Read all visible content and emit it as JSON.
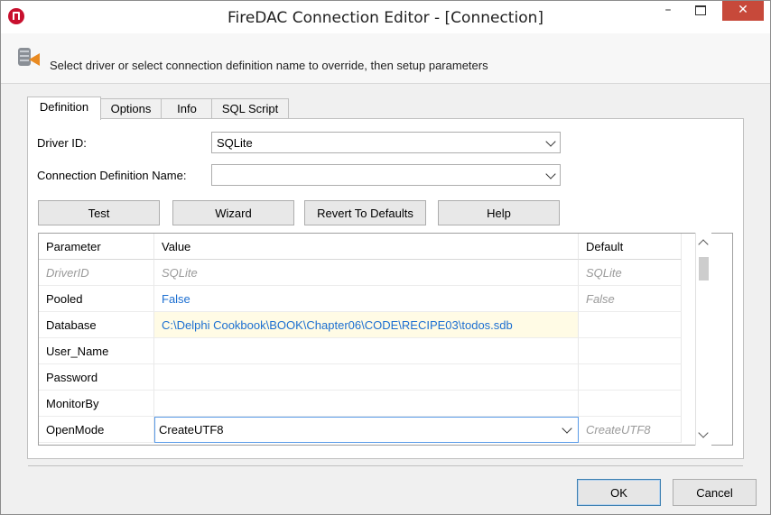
{
  "window": {
    "title": "FireDAC Connection Editor - [Connection]",
    "minimize_glyph": "–",
    "close_glyph": "✕"
  },
  "info_text": "Select driver or select connection definition name to override, then setup parameters",
  "tabs": [
    "Definition",
    "Options",
    "Info",
    "SQL Script"
  ],
  "active_tab": "Definition",
  "form": {
    "driver_label": "Driver ID:",
    "driver_value": "SQLite",
    "conn_def_label": "Connection Definition Name:",
    "conn_def_value": ""
  },
  "buttons": {
    "test": "Test",
    "wizard": "Wizard",
    "revert": "Revert To Defaults",
    "help": "Help"
  },
  "grid": {
    "headers": [
      "Parameter",
      "Value",
      "Default"
    ],
    "rows": [
      {
        "param": "DriverID",
        "value": "SQLite",
        "default": "SQLite"
      },
      {
        "param": "Pooled",
        "value": "False",
        "default": "False"
      },
      {
        "param": "Database",
        "value": "C:\\Delphi Cookbook\\BOOK\\Chapter06\\CODE\\RECIPE03\\todos.sdb",
        "default": ""
      },
      {
        "param": "User_Name",
        "value": "",
        "default": ""
      },
      {
        "param": "Password",
        "value": "",
        "default": ""
      },
      {
        "param": "MonitorBy",
        "value": "",
        "default": ""
      },
      {
        "param": "OpenMode",
        "value": "CreateUTF8",
        "default": "CreateUTF8"
      }
    ]
  },
  "dialog_buttons": {
    "ok": "OK",
    "cancel": "Cancel"
  },
  "colors": {
    "accent_blue": "#1c6fd1",
    "close_red": "#c7493a",
    "highlight_row": "#fffbe5",
    "app_icon_red": "#c8102e"
  }
}
